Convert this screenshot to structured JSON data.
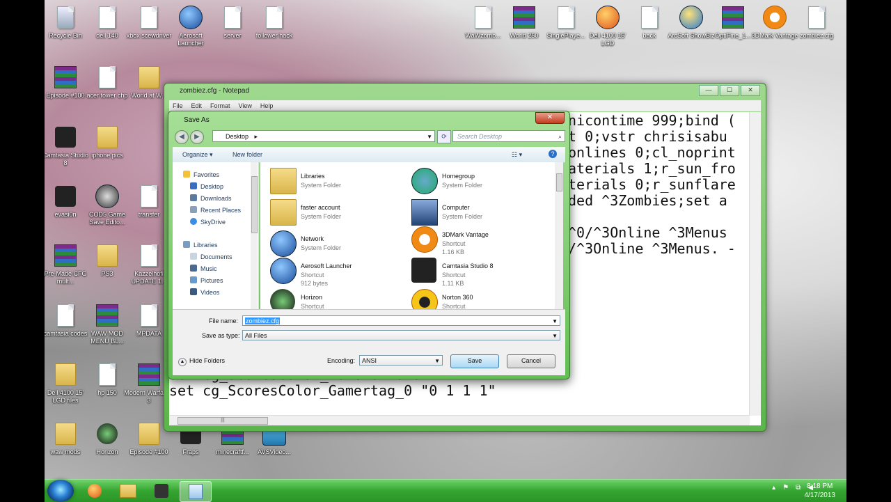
{
  "desktop": {
    "icons": [
      {
        "label": "Recycle Bin",
        "kind": "bin"
      },
      {
        "label": "dell 140",
        "kind": "doc"
      },
      {
        "label": "xbox scewdriver",
        "kind": "doc"
      },
      {
        "label": "Aerosoft Launcher",
        "kind": "round"
      },
      {
        "label": "server",
        "kind": "doc"
      },
      {
        "label": "follower hack",
        "kind": "doc"
      },
      {
        "label": "WaWzomb...",
        "kind": "doc"
      },
      {
        "label": "World 250",
        "kind": "rar"
      },
      {
        "label": "SinglePlaye...",
        "kind": "doc"
      },
      {
        "label": "Dell 4100 15' LGD",
        "kind": "round"
      },
      {
        "label": "back",
        "kind": "doc"
      },
      {
        "label": "ArcSoft ShowBiz",
        "kind": "round"
      },
      {
        "label": "OptiFine_1...",
        "kind": "rar"
      },
      {
        "label": "3DMark Vantage",
        "kind": "orange"
      },
      {
        "label": "zombiez.cfg",
        "kind": "doc"
      },
      {
        "label": "Episode #100",
        "kind": "rar"
      },
      {
        "label": "acer tower chp",
        "kind": "doc"
      },
      {
        "label": "World at W...",
        "kind": "folder"
      },
      {
        "label": "Camtasia Studio 8",
        "kind": "dark"
      },
      {
        "label": "iphone pics",
        "kind": "folder"
      },
      {
        "label": "evasi0n",
        "kind": "dark"
      },
      {
        "label": "COD5 Game Save Edito...",
        "kind": "round"
      },
      {
        "label": "transfer",
        "kind": "doc"
      },
      {
        "label": "Pre-Made CFG mult...",
        "kind": "rar"
      },
      {
        "label": "PS3",
        "kind": "folder"
      },
      {
        "label": "Kazzelhofi UPDATE 1...",
        "kind": "doc"
      },
      {
        "label": "camtasia codes",
        "kind": "doc"
      },
      {
        "label": "WAW MOD MENU BL...",
        "kind": "rar"
      },
      {
        "label": "MPDATA",
        "kind": "doc"
      },
      {
        "label": "Dell 4100 15' LGD files",
        "kind": "folder"
      },
      {
        "label": "hp 150",
        "kind": "doc"
      },
      {
        "label": "Modern Warfare® 3",
        "kind": "rar"
      },
      {
        "label": "waw mods",
        "kind": "folder"
      },
      {
        "label": "Horizon",
        "kind": "dark"
      },
      {
        "label": "Episode #100",
        "kind": "folder"
      },
      {
        "label": "Fraps",
        "kind": "dark"
      },
      {
        "label": "minecraftf...",
        "kind": "rar"
      },
      {
        "label": "AVSVideo...",
        "kind": "round"
      }
    ]
  },
  "notepad": {
    "title": "zombiez.cfg - Notepad",
    "menu": [
      "File",
      "Edit",
      "Format",
      "View",
      "Help"
    ],
    "controls": {
      "min": "—",
      "max": "☐",
      "close": "✕"
    },
    "lines": [
      "nicontime 999;bind (",
      "t 0;vstr chrisisabu",
      "onlines 0;cl_noprint",
      "aterials 1;r_sun_fro",
      "terials 0;r_sunflare",
      "ded ^3Zombies;set a",
      "^0/^3Online ^3Menus",
      "/^3Online ^3Menus. -",
      "set cg_ScoresColor_Zombie \"0 0 1 1\"",
      "set cg_ScoresColor_Gamertag_0 \"0 1 1 1\""
    ],
    "hscroll_grip": "|||"
  },
  "dialog": {
    "title": "Save As",
    "close": "✕",
    "address": "Desktop",
    "address_arrow": "▸",
    "search_placeholder": "Search Desktop",
    "toolbar": {
      "organize": "Organize ▾",
      "new_folder": "New folder",
      "view": "☷ ▾",
      "help": "?"
    },
    "nav": {
      "favorites": "Favorites",
      "desktop": "Desktop",
      "downloads": "Downloads",
      "recent": "Recent Places",
      "skydrive": "SkyDrive",
      "libraries": "Libraries",
      "documents": "Documents",
      "music": "Music",
      "pictures": "Pictures",
      "videos": "Videos"
    },
    "items": [
      {
        "name": "Libraries",
        "type": "System Folder",
        "size": ""
      },
      {
        "name": "Homegroup",
        "type": "System Folder",
        "size": ""
      },
      {
        "name": "faster account",
        "type": "System Folder",
        "size": ""
      },
      {
        "name": "Computer",
        "type": "System Folder",
        "size": ""
      },
      {
        "name": "Network",
        "type": "System Folder",
        "size": ""
      },
      {
        "name": "3DMark Vantage",
        "type": "Shortcut",
        "size": "1.16 KB"
      },
      {
        "name": "Aerosoft Launcher",
        "type": "Shortcut",
        "size": "912 bytes"
      },
      {
        "name": "Camtasia Studio 8",
        "type": "Shortcut",
        "size": "1.11 KB"
      },
      {
        "name": "Horizon",
        "type": "Shortcut",
        "size": ""
      },
      {
        "name": "Norton 360",
        "type": "Shortcut",
        "size": ""
      }
    ],
    "file_name_label": "File name:",
    "file_name": "zombiez.cfg",
    "save_as_type_label": "Save as type:",
    "save_as_type": "All Files",
    "hide_folders": "Hide Folders",
    "encoding_label": "Encoding:",
    "encoding": "ANSI",
    "save": "Save",
    "cancel": "Cancel"
  },
  "taskbar": {
    "time": "8:18 PM",
    "date": "4/17/2013"
  },
  "colors": {
    "taskbar": "#35a531",
    "dialog_frame": "#62bf52",
    "selection": "#3399ff"
  }
}
